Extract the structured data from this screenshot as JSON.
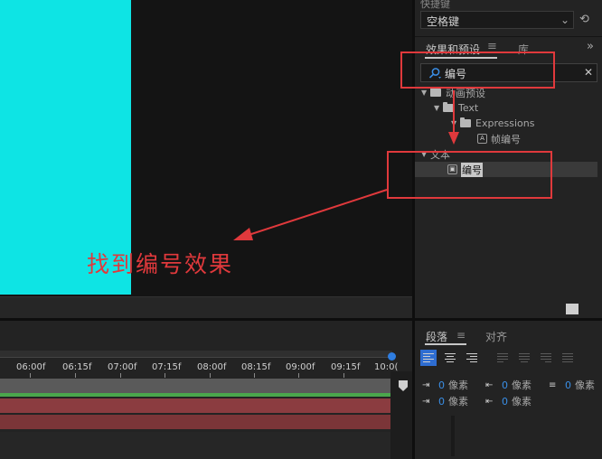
{
  "shortcut": {
    "label": "快捷键",
    "value": "空格键"
  },
  "effects_panel": {
    "tabs": [
      {
        "label": "效果和预设"
      },
      {
        "label": "库"
      }
    ],
    "search_value": "编号",
    "tree": [
      {
        "label": "动画预设",
        "level": 0
      },
      {
        "label": "Text",
        "level": 1
      },
      {
        "label": "Expressions",
        "level": 2
      },
      {
        "label": "帧编号",
        "level": 3
      },
      {
        "label": "文本",
        "level": 0
      },
      {
        "label": "编号",
        "level": 1
      }
    ]
  },
  "paragraph_panel": {
    "tabs": [
      {
        "label": "段落"
      },
      {
        "label": "对齐"
      }
    ],
    "fields": [
      {
        "value": "0",
        "unit": "像素"
      },
      {
        "value": "0",
        "unit": "像素"
      },
      {
        "value": "0",
        "unit": "像素"
      },
      {
        "value": "0",
        "unit": "像素"
      },
      {
        "value": "0",
        "unit": "像素"
      }
    ]
  },
  "timeline": {
    "ruler_labels": [
      "06:00f",
      "06:15f",
      "07:00f",
      "07:15f",
      "08:00f",
      "08:15f",
      "09:00f",
      "09:15f",
      "10:0("
    ]
  },
  "annotation": {
    "text": "找到编号效果",
    "color": "#e0393c"
  },
  "colors": {
    "comp_background": "#0ee4e4",
    "accent_blue": "#2e6dd1",
    "track_green": "#4aa74c",
    "track_red": "#8b3c40"
  }
}
